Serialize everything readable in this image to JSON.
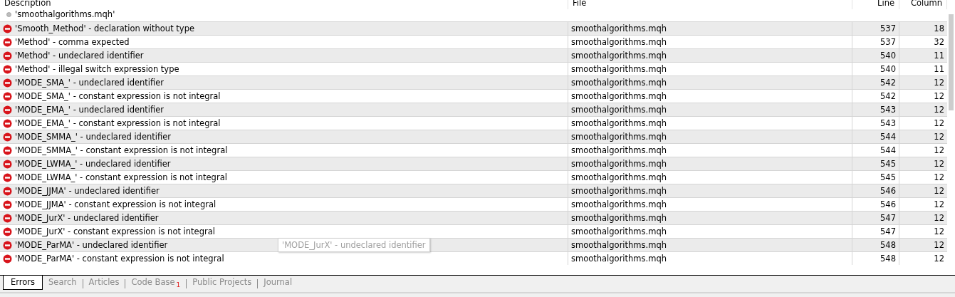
{
  "table": {
    "columns": [
      {
        "label": "Description"
      },
      {
        "label": "File"
      },
      {
        "label": "Line"
      },
      {
        "label": "Column"
      }
    ],
    "group": {
      "label": "'smoothalgorithms.mqh'"
    },
    "rows": [
      {
        "kind": "error",
        "description": "'Smooth_Method' - declaration without type",
        "file": "smoothalgorithms.mqh",
        "line": "537",
        "column": "18"
      },
      {
        "kind": "error",
        "description": "'Method' - comma expected",
        "file": "smoothalgorithms.mqh",
        "line": "537",
        "column": "32"
      },
      {
        "kind": "error",
        "description": "'Method' - undeclared identifier",
        "file": "smoothalgorithms.mqh",
        "line": "540",
        "column": "11"
      },
      {
        "kind": "error",
        "description": "'Method' - illegal switch expression type",
        "file": "smoothalgorithms.mqh",
        "line": "540",
        "column": "11"
      },
      {
        "kind": "error",
        "description": "'MODE_SMA_' - undeclared identifier",
        "file": "smoothalgorithms.mqh",
        "line": "542",
        "column": "12"
      },
      {
        "kind": "error",
        "description": "'MODE_SMA_' - constant expression is not integral",
        "file": "smoothalgorithms.mqh",
        "line": "542",
        "column": "12"
      },
      {
        "kind": "error",
        "description": "'MODE_EMA_' - undeclared identifier",
        "file": "smoothalgorithms.mqh",
        "line": "543",
        "column": "12"
      },
      {
        "kind": "error",
        "description": "'MODE_EMA_' - constant expression is not integral",
        "file": "smoothalgorithms.mqh",
        "line": "543",
        "column": "12"
      },
      {
        "kind": "error",
        "description": "'MODE_SMMA_' - undeclared identifier",
        "file": "smoothalgorithms.mqh",
        "line": "544",
        "column": "12"
      },
      {
        "kind": "error",
        "description": "'MODE_SMMA_' - constant expression is not integral",
        "file": "smoothalgorithms.mqh",
        "line": "544",
        "column": "12"
      },
      {
        "kind": "error",
        "description": "'MODE_LWMA_' - undeclared identifier",
        "file": "smoothalgorithms.mqh",
        "line": "545",
        "column": "12"
      },
      {
        "kind": "error",
        "description": "'MODE_LWMA_' - constant expression is not integral",
        "file": "smoothalgorithms.mqh",
        "line": "545",
        "column": "12"
      },
      {
        "kind": "error",
        "description": "'MODE_JJMA' - undeclared identifier",
        "file": "smoothalgorithms.mqh",
        "line": "546",
        "column": "12"
      },
      {
        "kind": "error",
        "description": "'MODE_JJMA' - constant expression is not integral",
        "file": "smoothalgorithms.mqh",
        "line": "546",
        "column": "12"
      },
      {
        "kind": "error",
        "description": "'MODE_JurX' - undeclared identifier",
        "file": "smoothalgorithms.mqh",
        "line": "547",
        "column": "12"
      },
      {
        "kind": "error",
        "description": "'MODE_JurX' - constant expression is not integral",
        "file": "smoothalgorithms.mqh",
        "line": "547",
        "column": "12"
      },
      {
        "kind": "error",
        "description": "'MODE_ParMA' - undeclared identifier",
        "file": "smoothalgorithms.mqh",
        "line": "548",
        "column": "12"
      },
      {
        "kind": "error",
        "description": "'MODE_ParMA' - constant expression is not integral",
        "file": "smoothalgorithms.mqh",
        "line": "548",
        "column": "12"
      }
    ]
  },
  "tooltip": {
    "text": "'MODE_JurX' - undeclared identifier"
  },
  "tabs": [
    {
      "label": "Errors",
      "selected": true
    },
    {
      "label": "Search",
      "selected": false
    },
    {
      "label": "Articles",
      "selected": false
    },
    {
      "label": "Code Base",
      "selected": false,
      "badge": "1"
    },
    {
      "label": "Public Projects",
      "selected": false
    },
    {
      "label": "Journal",
      "selected": false
    }
  ]
}
